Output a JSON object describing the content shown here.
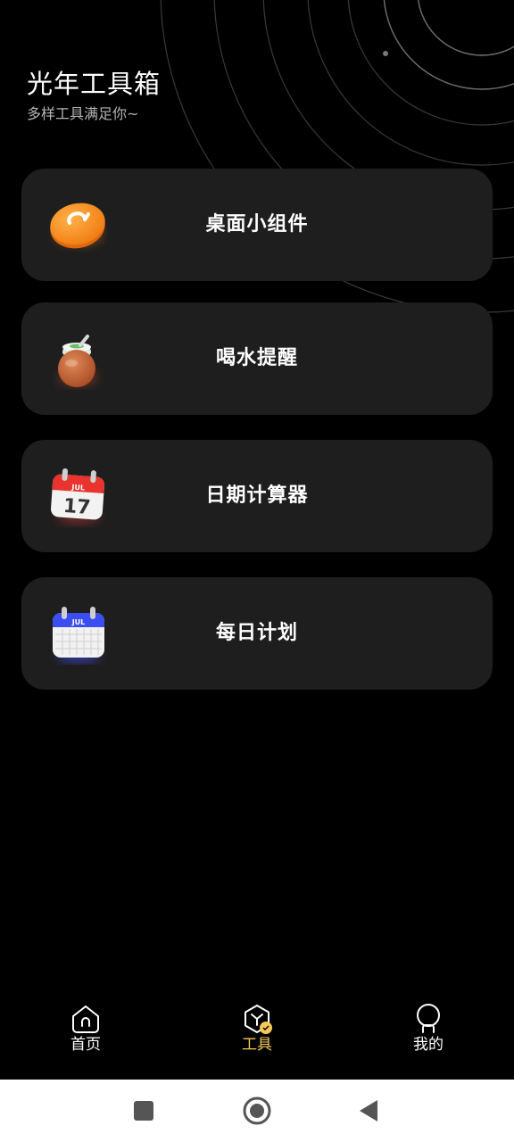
{
  "header": {
    "title": "光年工具箱",
    "subtitle": "多样工具满足你~"
  },
  "tools": [
    {
      "label": "桌面小组件",
      "icon": "orange-disc-icon"
    },
    {
      "label": "喝水提醒",
      "icon": "tea-jar-icon"
    },
    {
      "label": "日期计算器",
      "icon": "red-calendar-icon",
      "icon_month": "JUL",
      "icon_day": "17"
    },
    {
      "label": "每日计划",
      "icon": "blue-calendar-icon",
      "icon_month": "JUL"
    }
  ],
  "tabbar": {
    "items": [
      {
        "label": "首页",
        "icon": "home-icon",
        "active": false
      },
      {
        "label": "工具",
        "icon": "toolbox-icon",
        "active": true
      },
      {
        "label": "我的",
        "icon": "profile-icon",
        "active": false
      }
    ]
  },
  "colors": {
    "background": "#000000",
    "card": "#1e1e1e",
    "accent": "#f7c75a",
    "subtitle": "#b4b4b4"
  },
  "system_nav": {
    "items": [
      "recents-icon",
      "home-circle-icon",
      "back-icon"
    ]
  }
}
